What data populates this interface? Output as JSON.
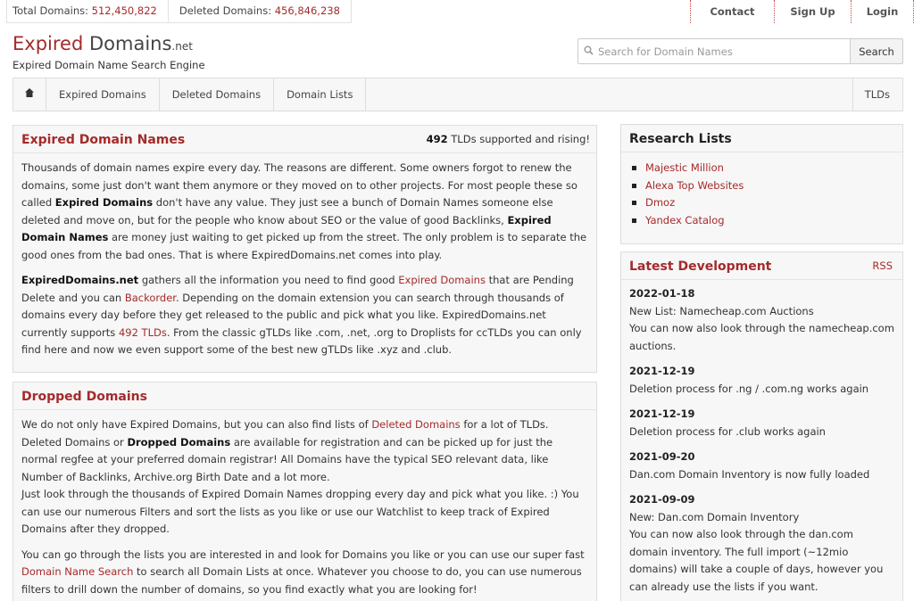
{
  "topbar": {
    "total_label": "Total Domains:",
    "total_value": "512,450,822",
    "deleted_label": "Deleted Domains:",
    "deleted_value": "456,846,238",
    "contact": "Contact",
    "signup": "Sign Up",
    "login": "Login"
  },
  "logo": {
    "main_red": "Expired",
    "main_gray": " Domains",
    "tld": ".net",
    "tagline": "Expired Domain Name Search Engine"
  },
  "search": {
    "placeholder": "Search for Domain Names",
    "button": "Search",
    "icon": "search-icon"
  },
  "nav": {
    "home_icon": "home-icon",
    "items": [
      "Expired Domains",
      "Deleted Domains",
      "Domain Lists"
    ],
    "right": "TLDs"
  },
  "expired": {
    "title": "Expired Domain Names",
    "tld_count": "492",
    "tld_text": " TLDs supported and rising!",
    "p1": {
      "a": "Thousands of domain names expire every day. The reasons are different. Some owners forgot to renew the domains, some just don't want them anymore or they moved on to other projects. For most people these so called ",
      "b1": "Expired Domains",
      "c": " don't have any value. They just see a bunch of Domain Names someone else deleted and move on, but for the people who know about SEO or the value of good Backlinks, ",
      "b2": "Expired Domain Names",
      "d": " are money just waiting to get picked up from the street. The only problem is to separate the good ones from the bad ones. That is where ExpiredDomains.net comes into play."
    },
    "p2": {
      "b": "ExpiredDomains.net",
      "a": " gathers all the information you need to find good ",
      "link1": "Expired Domains",
      "c": " that are Pending Delete and you can ",
      "link2": "Backorder",
      "d": ". Depending on the domain extension you can search through thousands of domains every day before they get released to the public and pick what you like. ExpiredDomains.net currently supports ",
      "link3": "492 TLDs",
      "e": ". From the classic gTLDs like .com, .net, .org to Droplists for ccTLDs you can only find here and now we even support some of the best new gTLDs like .xyz and .club."
    }
  },
  "dropped": {
    "title": "Dropped Domains",
    "p1": {
      "a": "We do not only have Expired Domains, but you can also find lists of ",
      "link1": "Deleted Domains",
      "b": " for a lot of TLDs. Deleted Domains or ",
      "bold1": "Dropped Domains",
      "c": " are available for registration and can be picked up for just the normal regfee at your preferred domain registrar! All Domains have the typical SEO relevant data, like Number of Backlinks, Archive.org Birth Date and a lot more.",
      "d": "Just look through the thousands of Expired Domain Names dropping every day and pick what you like. :) You can use our numerous Filters and sort the lists as you like or use our Watchlist to keep track of Expired Domains after they dropped."
    },
    "p2": {
      "a": "You can go through the lists you are interested in and look for Domains you like or you can use our super fast ",
      "link1": "Domain Name Search",
      "b": " to search all Domain Lists at once. Whatever you choose to do, you can use numerous filters to drill down the number of domains, so you find exactly what you are looking for!"
    }
  },
  "research": {
    "title": "Research Lists",
    "items": [
      "Majestic Million",
      "Alexa Top Websites",
      "Dmoz",
      "Yandex Catalog"
    ]
  },
  "latest": {
    "title": "Latest Development",
    "rss": "RSS",
    "items": [
      {
        "date": "2022-01-18",
        "lines": [
          "New List: Namecheap.com Auctions",
          "You can now also look through the namecheap.com auctions."
        ]
      },
      {
        "date": "2021-12-19",
        "lines": [
          "Deletion process for .ng / .com.ng works again"
        ]
      },
      {
        "date": "2021-12-19",
        "lines": [
          "Deletion process for .club works again"
        ]
      },
      {
        "date": "2021-09-20",
        "lines": [
          "Dan.com Domain Inventory is now fully loaded"
        ]
      },
      {
        "date": "2021-09-09",
        "lines": [
          "New: Dan.com Domain Inventory",
          "You can now also look through the dan.com domain inventory. The full import (~12mio domains) will take a couple of days, however you can already use the lists if you want."
        ]
      }
    ]
  },
  "colors": {
    "accent": "#a52a2a",
    "panel_bg": "#f7f7f7",
    "border": "#dddddd"
  }
}
